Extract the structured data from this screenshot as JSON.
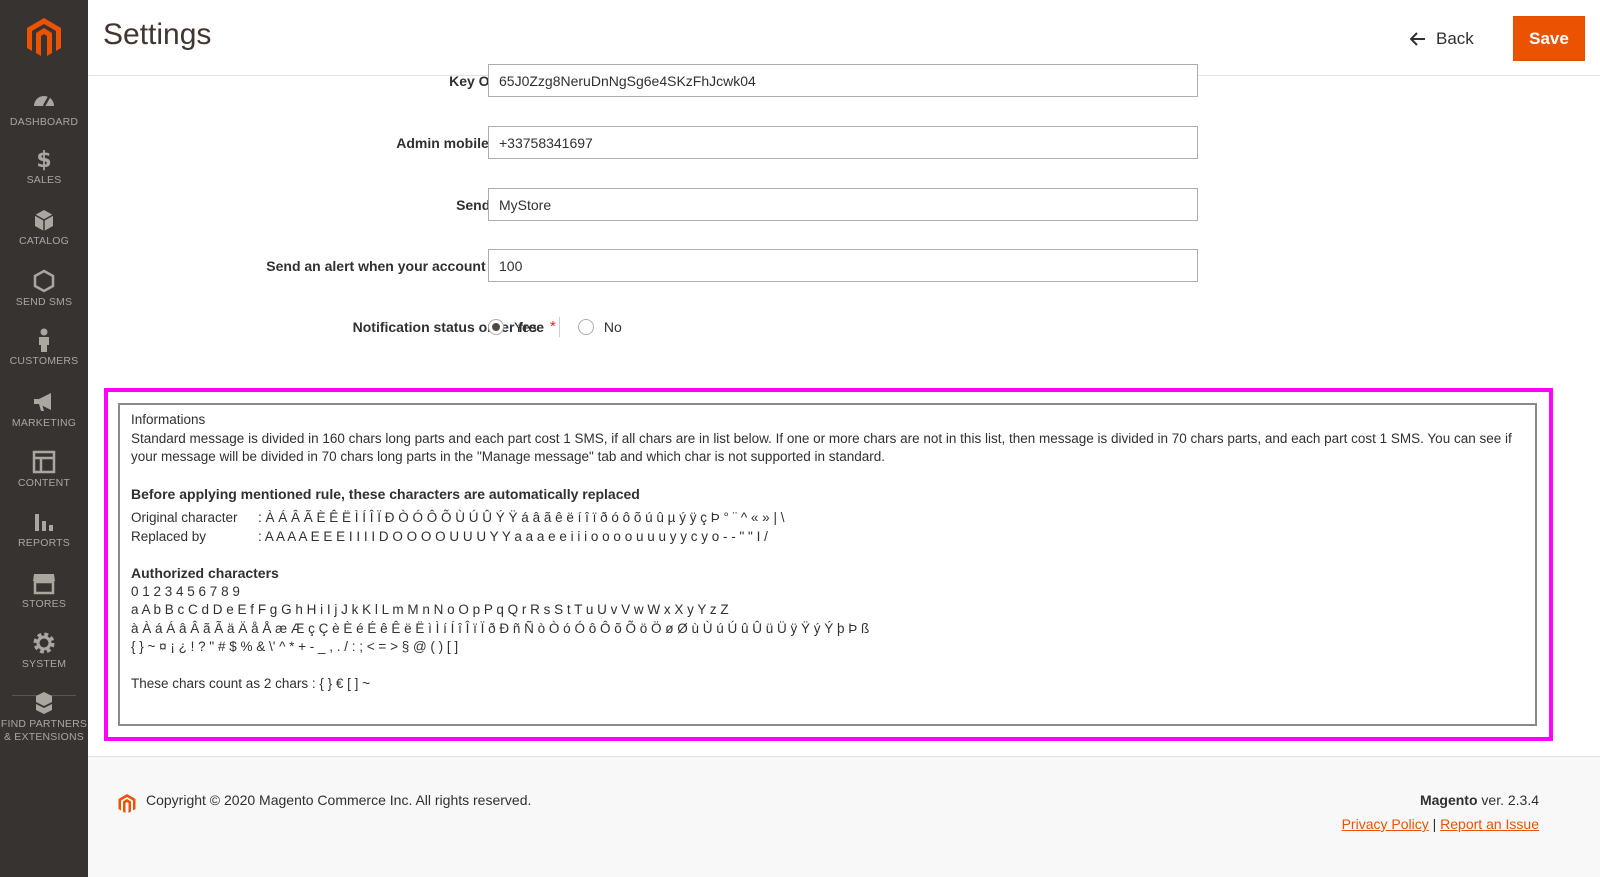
{
  "header": {
    "title": "Settings",
    "back_label": "Back",
    "save_label": "Save"
  },
  "sidebar": {
    "items": [
      {
        "label": "DASHBOARD",
        "icon": "dashboard-icon"
      },
      {
        "label": "SALES",
        "icon": "dollar-icon"
      },
      {
        "label": "CATALOG",
        "icon": "box-icon"
      },
      {
        "label": "SEND SMS",
        "icon": "hexagon-icon"
      },
      {
        "label": "CUSTOMERS",
        "icon": "person-icon"
      },
      {
        "label": "MARKETING",
        "icon": "megaphone-icon"
      },
      {
        "label": "CONTENT",
        "icon": "layout-icon"
      },
      {
        "label": "REPORTS",
        "icon": "bar-chart-icon"
      },
      {
        "label": "STORES",
        "icon": "store-icon"
      },
      {
        "label": "SYSTEM",
        "icon": "gear-icon"
      },
      {
        "label": "FIND PARTNERS & EXTENSIONS",
        "icon": "cubes-icon"
      }
    ]
  },
  "form": {
    "key_label": "Key Octopush",
    "key_value": "65J0Zzg8NeruDnNgSg6e4SKzFhJcwk04",
    "mobile_label": "Admin mobile number",
    "mobile_value": "+33758341697",
    "sender_label": "Sender name",
    "sender_value": "MyStore",
    "alert_label": "Send an alert when your account is under",
    "alert_value": "100",
    "notif_label": "Notification status order free",
    "yes_label": "Yes",
    "no_label": "No",
    "notif_selected": "Yes"
  },
  "info": {
    "title": "Informations",
    "description": "Standard message is divided in 160 chars long parts and each part cost 1 SMS, if all chars are in list below. If one or more chars are not in this list, then message is divided in 70 chars parts, and each part cost 1 SMS. You can see if your message will be divided in 70 chars long parts in the \"Manage message\" tab and which char is not supported in standard.",
    "replace_heading": "Before applying mentioned rule, these characters are automatically replaced",
    "original_label": "Original character",
    "original_chars": ": À Á Â Ã È Ê Ë Ì Í Î Ï Ð Ò Ó Ô Õ Ù Ú Û Ý Ÿ á â ã ê ë í î ï ð ó ô õ ú û µ ý ÿ ç Þ ° ¨ ^ « » | \\",
    "replaced_label": "Replaced by",
    "replaced_chars": ": A A A A E E E I I I I D O O O O U U U Y Y a a a e e i i i o o o o u u u y y c y o - - \" \" I /",
    "authorized_heading": "Authorized characters",
    "authorized_lines": [
      "0 1 2 3 4 5 6 7 8 9",
      "a A b B c C d D e E f F g G h H i I j J k K l L m M n N o O p P q Q r R s S t T u U v V w W x X y Y z Z",
      "à À á Á â Â ã Ã ä Ä å Å æ Æ ç Ç è È é É ê Ê ë Ë ì Ì í Í î Î ï Ï ð Ð ñ Ñ ò Ò ó Ó ô Ô õ Õ ö Ö ø Ø ù Ù ú Ú û Û ü Ü ÿ Ÿ ý Ý þ Þ ß",
      "{ } ~ ¤ ¡ ¿ ! ? \" # $ % & \\' ^ * + - _ , . / : ; < = > § @ ( ) [ ]"
    ],
    "double_chars": "These chars count as 2 chars : { } € [ ] ~"
  },
  "footer": {
    "copyright": "Copyright © 2020 Magento Commerce Inc. All rights reserved.",
    "brand": "Magento",
    "version": " ver. 2.3.4",
    "privacy_link": "Privacy Policy",
    "separator": " | ",
    "report_link": "Report an Issue"
  },
  "colors": {
    "sidebar_bg": "#373330",
    "accent": "#eb5202",
    "highlight": "#ff00ff"
  }
}
